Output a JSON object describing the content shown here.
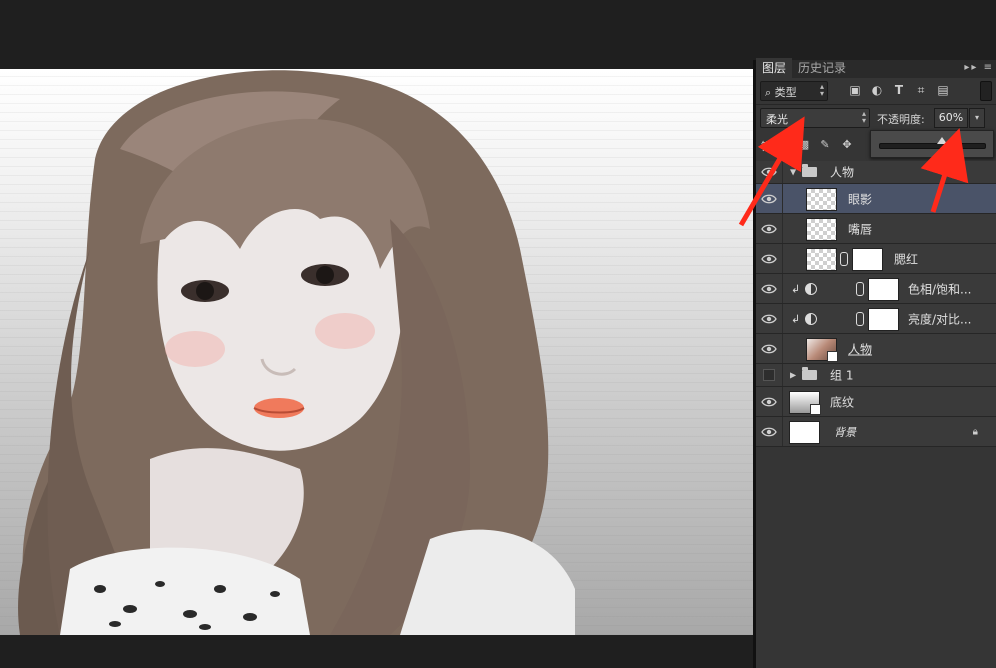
{
  "panel": {
    "tabs": [
      "图层",
      "历史记录"
    ],
    "menu_glyphs": "▸▸ ≡",
    "filter_kind": "类型",
    "blend_mode": "柔光",
    "opacity_label": "不透明度:",
    "opacity_value": "60%",
    "opacity_level": 0.6,
    "lock_label": "锁定"
  },
  "layers": [
    {
      "name": "人物",
      "type": "group-open"
    },
    {
      "name": "眼影",
      "type": "pixel",
      "selected": true
    },
    {
      "name": "嘴唇",
      "type": "pixel"
    },
    {
      "name": "腮红",
      "type": "pixel-masked"
    },
    {
      "name": "色相/饱和...",
      "type": "adjustment"
    },
    {
      "name": "亮度/对比...",
      "type": "adjustment"
    },
    {
      "name": "人物",
      "type": "smart-photo"
    },
    {
      "name": "组 1",
      "type": "group-closed",
      "hidden": true
    },
    {
      "name": "底纹",
      "type": "smart-gradient"
    },
    {
      "name": "背景",
      "type": "background",
      "locked": true
    }
  ],
  "colors": {
    "accent_arrow": "#ff2a1a",
    "selected_row": "#4a5368",
    "panel_bg": "#353535"
  }
}
